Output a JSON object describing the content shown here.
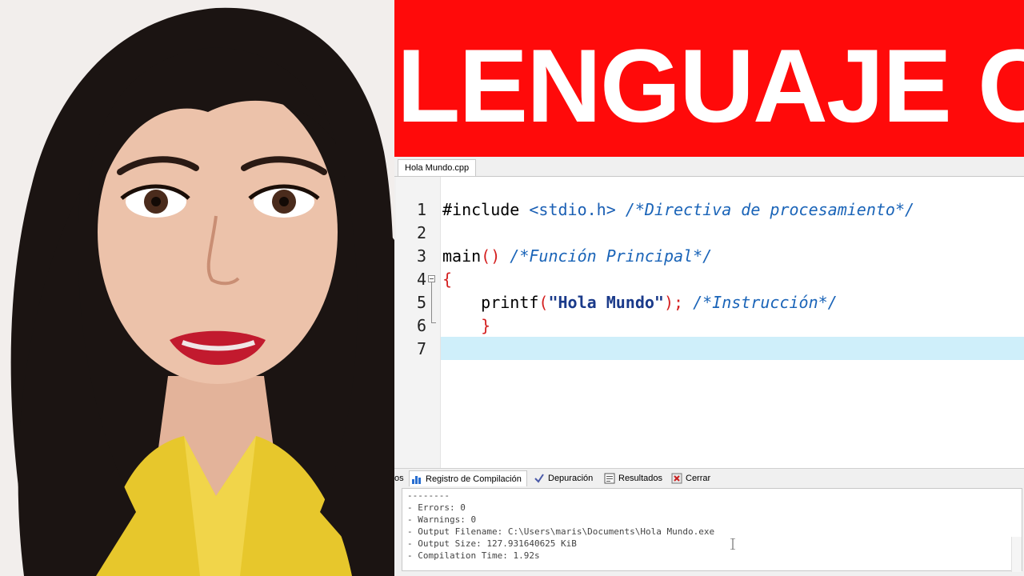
{
  "thumbnail": {
    "title": "LENGUAJE C"
  },
  "editor": {
    "tab_label": "Hola Mundo.cpp",
    "line_numbers": [
      "1",
      "2",
      "3",
      "4",
      "5",
      "6",
      "7"
    ],
    "lines": {
      "l1_directive": "#include ",
      "l1_header": "<stdio.h>",
      "l1_comment": " /*Directiva de procesamiento*/",
      "l3_main": "main",
      "l3_parens": "()",
      "l3_comment": " /*Función Principal*/",
      "l4_brace": "{",
      "l5_indent": "    ",
      "l5_printf": "printf",
      "l5_open": "(",
      "l5_string": "\"Hola Mundo\"",
      "l5_close": ");",
      "l5_comment": " /*Instrucción*/",
      "l6_indent": "    ",
      "l6_brace": "}"
    }
  },
  "bottom_panel": {
    "tabs": [
      {
        "label": "os",
        "icon": "cut-off-tab"
      },
      {
        "label": "Registro de Compilación",
        "icon": "bar-chart-icon"
      },
      {
        "label": "Depuración",
        "icon": "check-icon"
      },
      {
        "label": "Resultados",
        "icon": "results-icon"
      },
      {
        "label": "Cerrar",
        "icon": "close-icon"
      }
    ],
    "log_lines": [
      "--------",
      "- Errors: 0",
      "- Warnings: 0",
      "- Output Filename: C:\\Users\\maris\\Documents\\Hola Mundo.exe",
      "- Output Size: 127.931640625 KiB",
      "- Compilation Time: 1.92s"
    ]
  },
  "colors": {
    "background": "#ff0a0a",
    "title_text": "#ffffff",
    "active_line": "#cfeffa",
    "comment": "#1a64b8",
    "bracket": "#d42020"
  }
}
